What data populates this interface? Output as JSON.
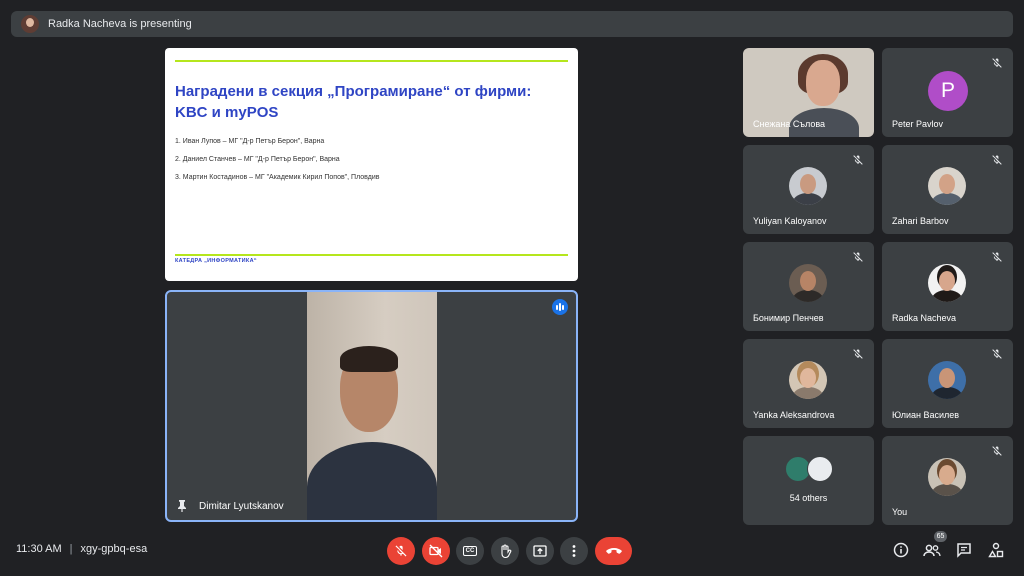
{
  "presenting": {
    "text": "Radka Nacheva is presenting"
  },
  "slide": {
    "title_line1": "Наградени в секция „Програмиране“ от фирми:",
    "title_line2": "KBC и myPOS",
    "items": [
      "1. Иван Лупов – МГ \"Д-р Петър Берон\", Варна",
      "2. Даниел Станчев – МГ \"Д-р Петър Берон\", Варна",
      "3. Мартин Костадинов – МГ \"Академик Кирил Попов\", Пловдив"
    ],
    "footer": "КАТЕДРА „ИНФОРМАТИКА“"
  },
  "speaker": {
    "name": "Dimitar Lyutskanov"
  },
  "participants": {
    "t0": "Снежана Сълова",
    "t1": "Peter Pavlov",
    "t1_letter": "P",
    "t2": "Yuliyan Kaloyanov",
    "t3": "Zahari Barbov",
    "t4": "Бонимир Пенчев",
    "t5": "Radka Nacheva",
    "t6": "Yanka Aleksandrova",
    "t7": "Юлиан Василев",
    "t8": "54 others",
    "t9": "You"
  },
  "bottom": {
    "time": "11:30 AM",
    "separator": "|",
    "meeting_code": "xgy-gpbq-esa",
    "people_count": "65",
    "cc_label": "CC"
  },
  "colors": {
    "accent": "#8ab4f8",
    "danger": "#ea4335",
    "slide_title": "#2f45c4",
    "slide_line": "#b5e61d",
    "letter_avatar": "#b04dc8"
  },
  "icons": [
    "mic-off-icon",
    "video-off-icon",
    "captions-icon",
    "raise-hand-icon",
    "present-icon",
    "more-icon",
    "end-call-icon",
    "info-icon",
    "people-icon",
    "chat-icon",
    "activities-icon",
    "pin-icon",
    "audio-level-icon"
  ]
}
